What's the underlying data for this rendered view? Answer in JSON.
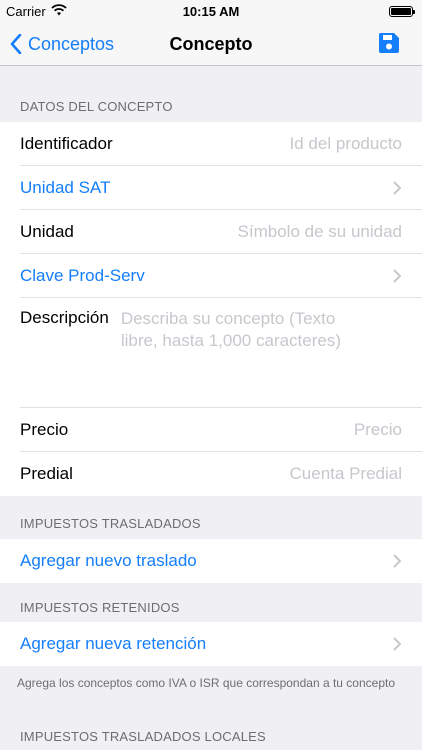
{
  "status_bar": {
    "carrier": "Carrier",
    "time": "10:15 AM"
  },
  "nav": {
    "back_label": "Conceptos",
    "title": "Concepto",
    "save_icon": "floppy-disk-icon"
  },
  "sections": {
    "datos": {
      "header": "DATOS DEL CONCEPTO",
      "identificador": {
        "label": "Identificador",
        "placeholder": "Id del producto"
      },
      "unidad_sat": {
        "label": "Unidad SAT"
      },
      "unidad": {
        "label": "Unidad",
        "placeholder": "Símbolo de su unidad"
      },
      "clave": {
        "label": "Clave Prod-Serv"
      },
      "descripcion": {
        "label": "Descripción",
        "placeholder": "Describa su concepto (Texto libre, hasta 1,000 caracteres)"
      },
      "precio": {
        "label": "Precio",
        "placeholder": "Precio"
      },
      "predial": {
        "label": "Predial",
        "placeholder": "Cuenta Predial"
      }
    },
    "trasladados": {
      "header": "IMPUESTOS TRASLADADOS",
      "action": "Agregar nuevo traslado"
    },
    "retenidos": {
      "header": "IMPUESTOS RETENIDOS",
      "action": "Agregar nueva retención",
      "footer": "Agrega los conceptos como IVA o ISR que correspondan a tu concepto"
    },
    "locales": {
      "header": "IMPUESTOS TRASLADADOS LOCALES"
    }
  },
  "colors": {
    "accent": "#147EFB",
    "background": "#EFEFF4",
    "placeholder": "#C7C7CD",
    "section_text": "#6D6D72"
  }
}
